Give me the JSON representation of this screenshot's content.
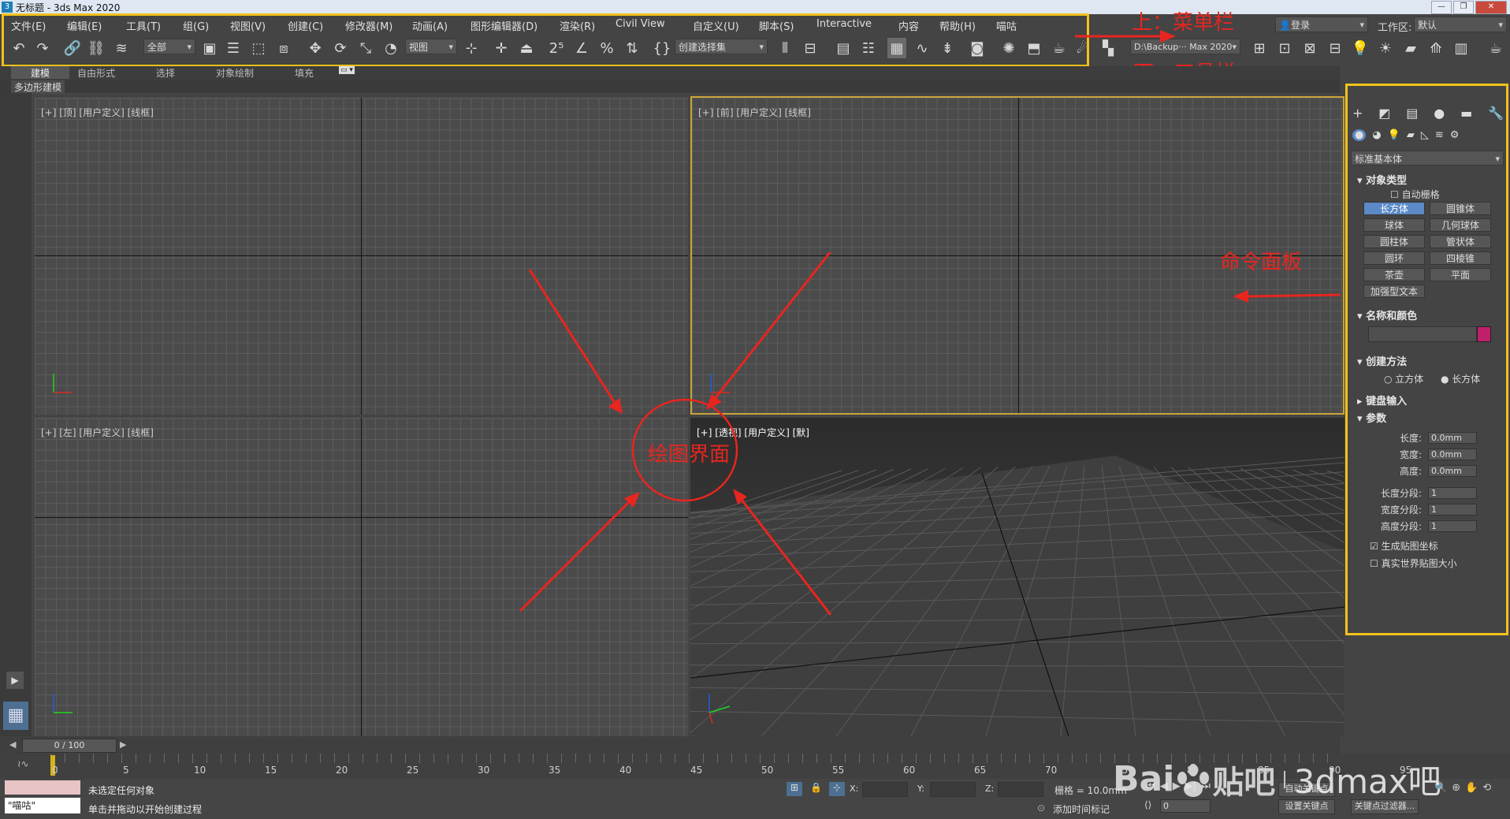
{
  "window": {
    "title": "无标题 - 3ds Max 2020",
    "icon": "app-3"
  },
  "menu": [
    "文件(E)",
    "编辑(E)",
    "工具(T)",
    "组(G)",
    "视图(V)",
    "创建(C)",
    "修改器(M)",
    "动画(A)",
    "图形编辑器(D)",
    "渲染(R)",
    "Civil View",
    "自定义(U)",
    "脚本(S)",
    "Interactive",
    "内容",
    "帮助(H)",
    "喵咕"
  ],
  "toolbar": {
    "selection_filter": "全部",
    "ref_coord": "视图",
    "named_selection": "创建选择集",
    "project_path": "D:\\Backup··· Max 2020"
  },
  "header_right": {
    "login": "登录",
    "workspace_label": "工作区:",
    "workspace_value": "默认"
  },
  "ribbon": {
    "tabs": [
      "建模",
      "自由形式",
      "选择",
      "对象绘制",
      "填充"
    ],
    "subtab": "多边形建模"
  },
  "viewports": {
    "top": "[+] [顶] [用户定义] [线框]",
    "front": "[+] [前] [用户定义] [线框]",
    "left": "[+] [左] [用户定义] [线框]",
    "persp": "[+] [透视] [用户定义] [默]"
  },
  "command_panel": {
    "category": "标准基本体",
    "object_type_title": "对象类型",
    "autogrid": "自动栅格",
    "buttons": [
      "长方体",
      "圆锥体",
      "球体",
      "几何球体",
      "圆柱体",
      "管状体",
      "圆环",
      "四棱锥",
      "茶壶",
      "平面",
      "加强型文本"
    ],
    "name_color_title": "名称和颜色",
    "swatch_color": "#c0206a",
    "creation_method_title": "创建方法",
    "creation_options": [
      "立方体",
      "长方体"
    ],
    "keyboard_entry_title": "键盘输入",
    "params_title": "参数",
    "params": [
      {
        "label": "长度:",
        "value": "0.0mm"
      },
      {
        "label": "宽度:",
        "value": "0.0mm"
      },
      {
        "label": "高度:",
        "value": "0.0mm"
      },
      {
        "label": "长度分段:",
        "value": "1"
      },
      {
        "label": "宽度分段:",
        "value": "1"
      },
      {
        "label": "高度分段:",
        "value": "1"
      }
    ],
    "gen_mapping": "生成贴图坐标",
    "real_world": "真实世界贴图大小"
  },
  "timeline": {
    "frame_counter": "0 / 100",
    "ticks": [
      "0",
      "5",
      "10",
      "15",
      "20",
      "25",
      "30",
      "35",
      "40",
      "45",
      "50",
      "55",
      "60",
      "65",
      "70",
      "75",
      "80",
      "85",
      "90",
      "95"
    ]
  },
  "status": {
    "maxscript": "\"喵咕\"",
    "line1": "未选定任何对象",
    "line2": "单击并拖动以开始创建过程",
    "x_label": "X:",
    "y_label": "Y:",
    "z_label": "Z:",
    "grid": "栅格 = 10.0mm",
    "add_time_tag": "添加时间标记",
    "auto_key": "自动关键点",
    "set_key": "设置关键点",
    "key_filters": "关键点过滤器...",
    "frame_value": "0"
  },
  "annotations": {
    "menubar": "上：菜单栏",
    "toolbar": "下：工具栏",
    "command_panel": "命令面板",
    "drawing_area": "绘图界面",
    "color": "#e8251f"
  },
  "watermark": {
    "baidu": "Bai",
    "tieba": "贴吧",
    "site": "3dmax吧"
  }
}
